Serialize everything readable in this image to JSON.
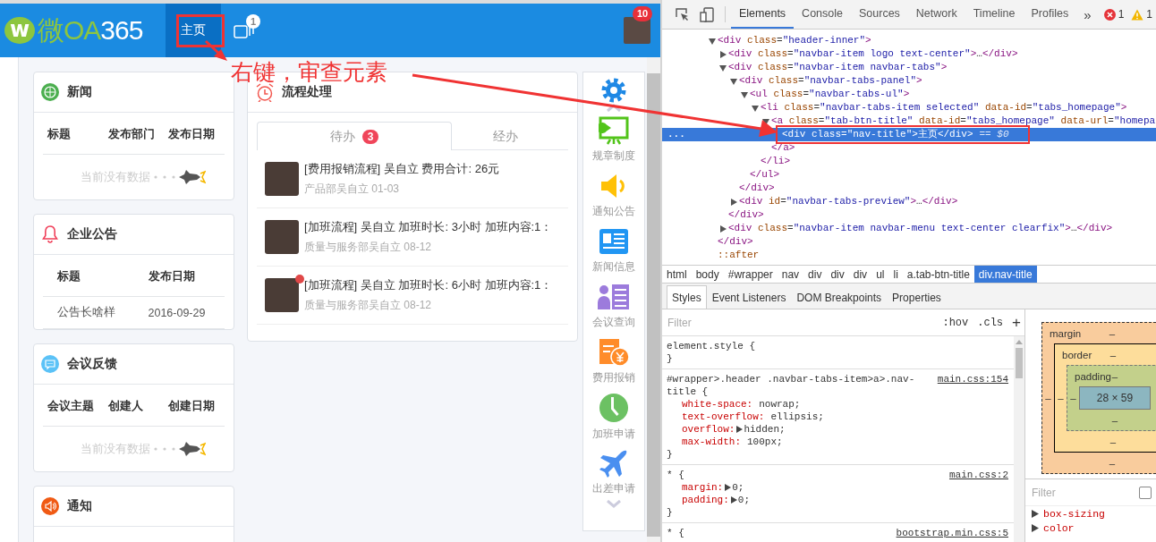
{
  "app": {
    "logo": {
      "mark": "w",
      "brand": "微OA",
      "number": "365"
    },
    "nav_tabs": [
      {
        "label": "主页",
        "selected": true
      }
    ],
    "preview_badge": "1",
    "avatar_badge": "10"
  },
  "cards": [
    {
      "kind": "news",
      "title": "新闻",
      "columns": [
        "标题",
        "发布部门",
        "发布日期"
      ],
      "empty_text": "当前没有数据"
    },
    {
      "kind": "bell",
      "title": "企业公告",
      "columns": [
        "标题",
        "发布日期"
      ],
      "rows": [
        [
          "公告长啥样",
          "2016-09-29"
        ]
      ]
    },
    {
      "kind": "chat",
      "title": "会议反馈",
      "columns": [
        "会议主题",
        "创建人",
        "创建日期"
      ],
      "empty_text": "当前没有数据"
    },
    {
      "kind": "speaker",
      "title": "通知"
    }
  ],
  "process": {
    "title": "流程处理",
    "tabs": [
      {
        "label": "待办",
        "badge": "3",
        "selected": true
      },
      {
        "label": "经办",
        "selected": false
      }
    ],
    "items": [
      {
        "title": "[费用报销流程] 吴自立 费用合计: 26元",
        "meta": "产品部吴自立 01-03",
        "unread": false
      },
      {
        "title": "[加班流程] 吴自立 加班时长: 3小时 加班内容:1：",
        "meta": "质量与服务部吴自立 08-12",
        "unread": false
      },
      {
        "title": "[加班流程] 吴自立 加班时长: 6小时 加班内容:1：",
        "meta": "质量与服务部吴自立 08-12",
        "unread": true
      }
    ]
  },
  "quick_links": [
    {
      "kind": "rules",
      "label": "规章制度"
    },
    {
      "kind": "notice",
      "label": "通知公告"
    },
    {
      "kind": "news",
      "label": "新闻信息"
    },
    {
      "kind": "meeting",
      "label": "会议查询"
    },
    {
      "kind": "expense",
      "label": "费用报销"
    },
    {
      "kind": "overtime",
      "label": "加班申请"
    },
    {
      "kind": "trip",
      "label": "出差申请"
    }
  ],
  "annotation": {
    "text": "右键，审查元素"
  },
  "devtools": {
    "tabs": [
      {
        "label": "Elements",
        "selected": true
      },
      {
        "label": "Console",
        "selected": false
      },
      {
        "label": "Sources",
        "selected": false
      },
      {
        "label": "Network",
        "selected": false
      },
      {
        "label": "Timeline",
        "selected": false
      },
      {
        "label": "Profiles",
        "selected": false
      }
    ],
    "more": "»",
    "errors": "1",
    "warnings": "1",
    "dom": [
      {
        "open": "<div class=\"header-inner\">",
        "expanded": true,
        "selected": false,
        "close": "</div>",
        "children": [
          {
            "open": "<div class=\"navbar-item logo text-center\">…</div>",
            "expanded": false,
            "selected": false
          },
          {
            "open": "<div class=\"navbar-item navbar-tabs\">",
            "expanded": true,
            "selected": false,
            "close": "</div>",
            "children": [
              {
                "open": "<div class=\"navbar-tabs-panel\">",
                "expanded": true,
                "selected": false,
                "close": "</div>",
                "children": [
                  {
                    "open": "<ul class=\"navbar-tabs-ul\">",
                    "expanded": true,
                    "selected": false,
                    "close": "</ul>",
                    "children": [
                      {
                        "open": "<li class=\"navbar-tabs-item selected\" data-id=\"tabs_homepage\">",
                        "expanded": true,
                        "selected": false,
                        "close": "</li>",
                        "children": [
                          {
                            "open": "<a class=\"tab-btn-title\" data-id=\"tabs_homepage\" data-url=\"homepa",
                            "expanded": true,
                            "selected": false,
                            "close": "</a>",
                            "children": [
                              {
                                "open": "<div class=\"nav-title\">主页</div>",
                                "suffix": "== $0",
                                "gutter": "...",
                                "selected": true
                              }
                            ]
                          }
                        ]
                      }
                    ]
                  }
                ]
              },
              {
                "open": "<div id=\"navbar-tabs-preview\">…</div>",
                "expanded": false,
                "selected": false
              }
            ]
          },
          {
            "open": "<div class=\"navbar-item navbar-menu text-center clearfix\">…</div>",
            "expanded": false,
            "selected": false
          }
        ]
      },
      {
        "open": "::after",
        "selected": false
      }
    ],
    "breadcrumbs": [
      {
        "label": "html",
        "selected": false
      },
      {
        "label": "body",
        "selected": false
      },
      {
        "label": "#wrapper",
        "selected": false
      },
      {
        "label": "nav",
        "selected": false
      },
      {
        "label": "div",
        "selected": false
      },
      {
        "label": "div",
        "selected": false
      },
      {
        "label": "div",
        "selected": false
      },
      {
        "label": "ul",
        "selected": false
      },
      {
        "label": "li",
        "selected": false
      },
      {
        "label": "a.tab-btn-title",
        "selected": false
      },
      {
        "label": "div.nav-title",
        "selected": true
      }
    ],
    "pane_tabs": [
      {
        "label": "Styles",
        "selected": true
      },
      {
        "label": "Event Listeners",
        "selected": false
      },
      {
        "label": "DOM Breakpoints",
        "selected": false
      },
      {
        "label": "Properties",
        "selected": false
      }
    ],
    "styles": {
      "filter_placeholder": "Filter",
      "hov": ":hov",
      "cls": ".cls",
      "add": "+",
      "rules": [
        {
          "selector": "element.style {",
          "close": "}"
        },
        {
          "selector": "#wrapper>.header .navbar-tabs-item>a>.nav-title {",
          "source": "main.css:154",
          "close": "}",
          "properties": [
            {
              "text": "white-space: nowrap;",
              "expandable": false
            },
            {
              "text": "text-overflow: ellipsis;",
              "expandable": false
            },
            {
              "text": "overflow: hidden;",
              "expandable": true
            },
            {
              "text": "max-width: 100px;",
              "expandable": false
            }
          ]
        },
        {
          "selector": "* {",
          "source": "main.css:2",
          "close": "}",
          "properties": [
            {
              "text": "margin: 0;",
              "expandable": true
            },
            {
              "text": "padding: 0;",
              "expandable": true
            }
          ]
        },
        {
          "selector": "* {",
          "source": "bootstrap.min.css:5"
        }
      ]
    },
    "box_model": {
      "margin": {
        "label": "margin",
        "top": "–",
        "left": "–",
        "bottom": "–"
      },
      "border": {
        "label": "border",
        "top": "–",
        "left": "–",
        "bottom": "–"
      },
      "padding": {
        "label": "padding",
        "top": "–",
        "left": "–",
        "bottom": "–"
      },
      "content": "28 × 59"
    },
    "computed": {
      "filter_placeholder": "Filter",
      "show_all_checked": false,
      "properties": [
        "box-sizing",
        "color"
      ]
    }
  }
}
